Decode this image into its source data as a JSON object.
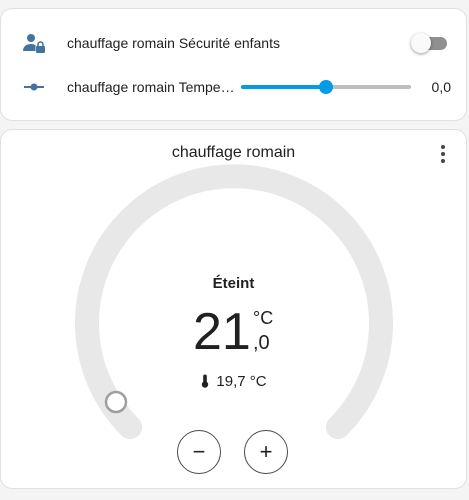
{
  "entities": {
    "child_lock": {
      "label": "chauffage romain Sécurité enfants",
      "icon": "account-lock-icon",
      "state": "off"
    },
    "temperature_offset": {
      "label": "chauffage romain Tempera...",
      "icon": "ray-vertex-icon",
      "value_text": "0,0",
      "level": 0.5
    }
  },
  "thermostat": {
    "title": "chauffage romain",
    "menu_icon": "dots-vertical-icon",
    "state": "Éteint",
    "target_integer": "21",
    "target_decimal": ",0",
    "unit": "°C",
    "current_temperature": "19,7 °C",
    "current_icon": "thermometer-icon",
    "minus_label": "−",
    "plus_label": "+"
  },
  "colors": {
    "accent": "#039be5",
    "track": "#e8e8e8",
    "toggle_off": "#8f8f8f"
  }
}
